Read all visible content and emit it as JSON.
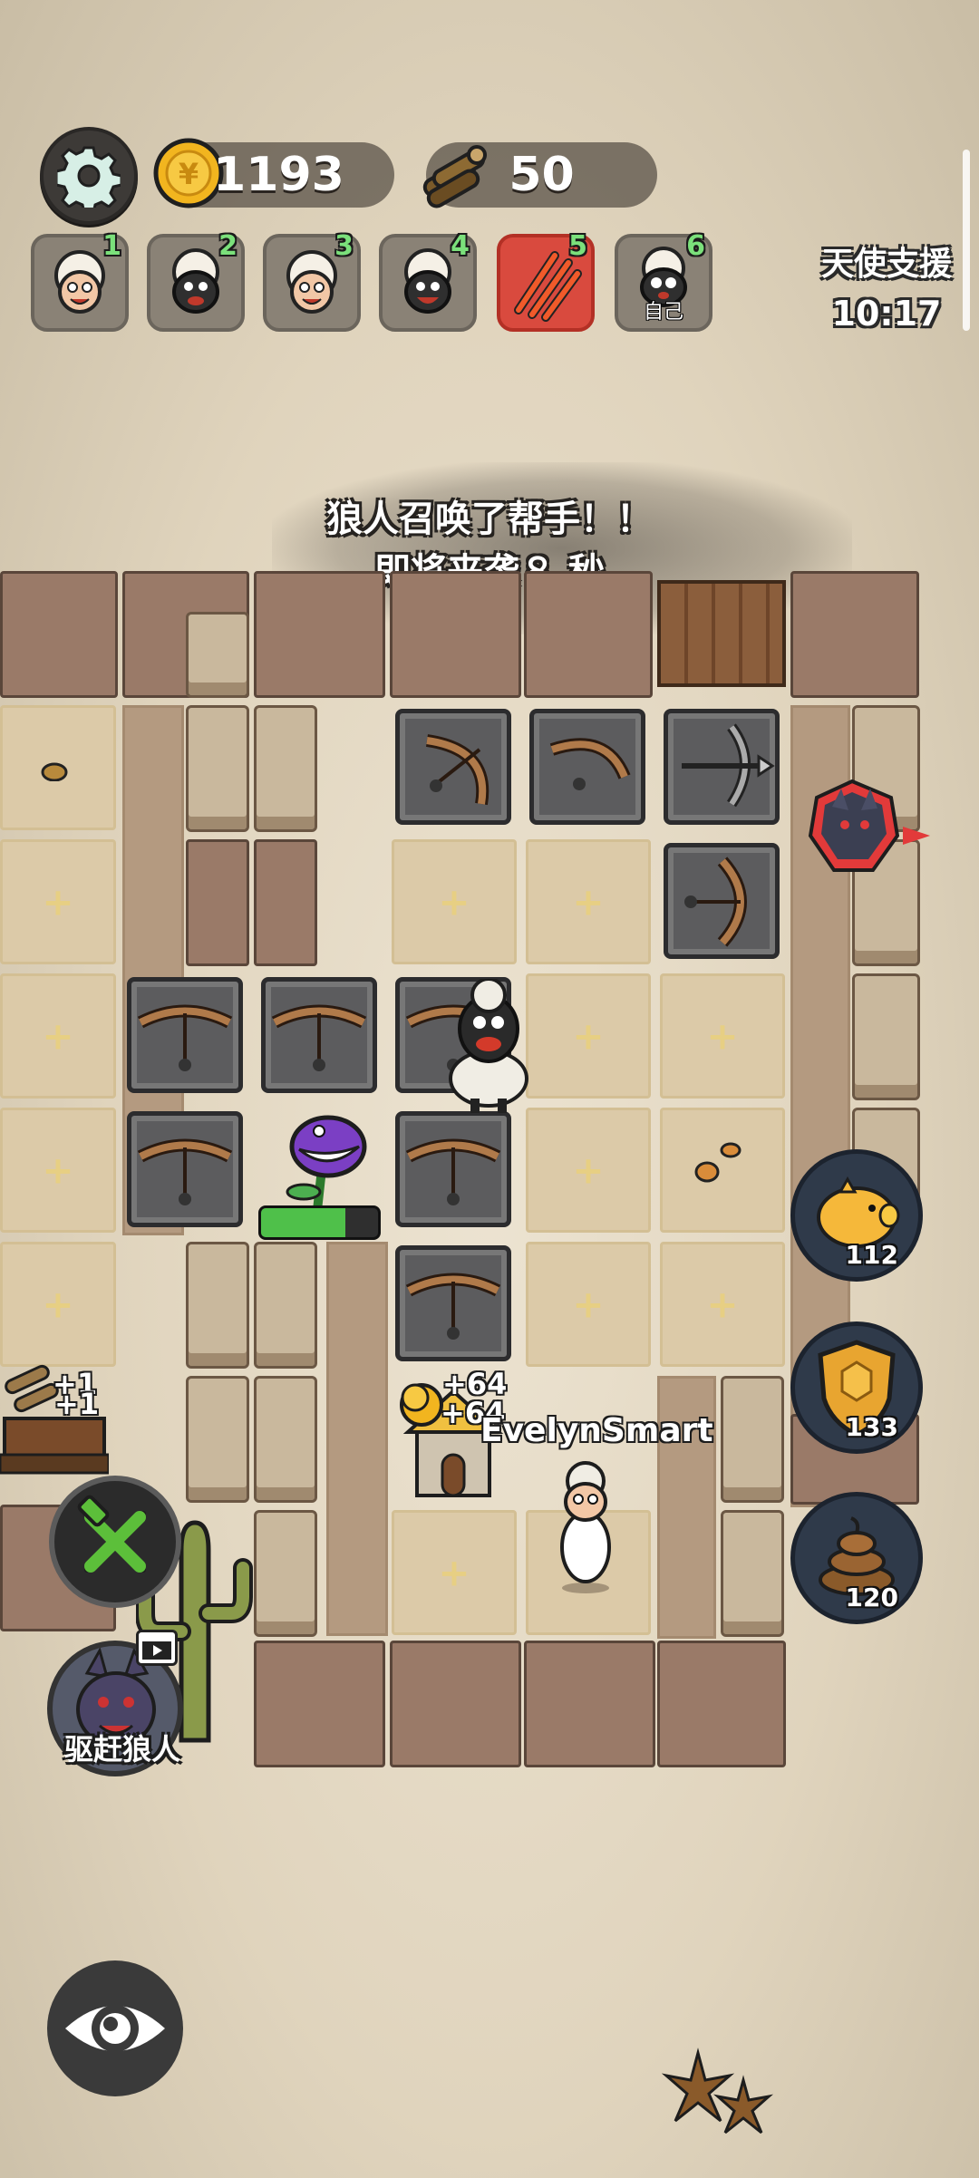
{
  "hud": {
    "coins": "1193",
    "wood": "50",
    "angel_support_label": "天使支援",
    "angel_support_timer": "10:17"
  },
  "players": [
    {
      "num": "1",
      "icon": "white-sheep-icon",
      "self_label": ""
    },
    {
      "num": "2",
      "icon": "black-sheep-icon",
      "self_label": ""
    },
    {
      "num": "3",
      "icon": "white-sheep-icon",
      "self_label": ""
    },
    {
      "num": "4",
      "icon": "black-sheep-icon",
      "self_label": ""
    },
    {
      "num": "5",
      "icon": "werewolf-claw-icon",
      "self_label": ""
    },
    {
      "num": "6",
      "icon": "black-sheep-icon",
      "self_label": "自己"
    }
  ],
  "announcement": {
    "line1": "狼人召唤了帮手！！",
    "line2": "即将来袭８ 秒"
  },
  "board": {
    "player_name": "EvelynSmart",
    "wood_gain": "+1",
    "coin_gain": "+64",
    "plant_hp_fraction": 0.72
  },
  "side_buttons": {
    "piggy_bank": "112",
    "shield": "133",
    "poop": "120"
  },
  "actions": {
    "drive_wolf_label": "驱赶狼人"
  },
  "colors": {
    "active_slot": "#d94a3e",
    "number_green": "#7be07b",
    "hp_green": "#4fc04a"
  }
}
